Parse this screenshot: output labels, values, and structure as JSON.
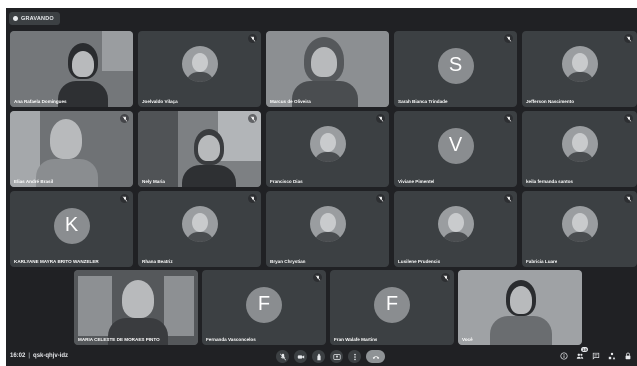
{
  "recording": {
    "label": "GRAVANDO"
  },
  "participants": [
    {
      "name": "Ana Rafaela Domingues"
    },
    {
      "name": "Joelvaldo Vilaça"
    },
    {
      "name": "Marcus de Oliveira"
    },
    {
      "name": "Sarah Bianca Trindade",
      "initial": "S"
    },
    {
      "name": "Jefferson Nascimento"
    },
    {
      "name": "Elias André Brasil"
    },
    {
      "name": "Nely Maria"
    },
    {
      "name": "Francisco Dias"
    },
    {
      "name": "Viviane Pimentel",
      "initial": "V"
    },
    {
      "name": "keila fernanda santos"
    },
    {
      "name": "KARLYANE MAYRA BRITO WANZELER",
      "initial": "K"
    },
    {
      "name": "Rhana Beatriz"
    },
    {
      "name": "Bryan Chrystian"
    },
    {
      "name": "Lusilene Prudencio"
    },
    {
      "name": "Fabricia Luare"
    },
    {
      "name": "MARIA CELESTE DE MORAES PINTO"
    },
    {
      "name": "Fernanda Vasconcelos",
      "initial": "F"
    },
    {
      "name": "Fran Walafe Martins",
      "initial": "F"
    },
    {
      "name": "Você"
    }
  ],
  "meeting": {
    "time": "16:02",
    "code": "qsk-qhjv-idz",
    "people_count": "19"
  },
  "icons": {
    "mic": "mic-off-icon",
    "camera": "camera-icon",
    "hand": "raise-hand-icon",
    "present": "present-icon",
    "more": "more-vert-icon",
    "end": "end-call-icon",
    "info": "info-icon",
    "people": "people-icon",
    "chat": "chat-icon",
    "activities": "activities-icon",
    "lock": "host-controls-icon"
  }
}
